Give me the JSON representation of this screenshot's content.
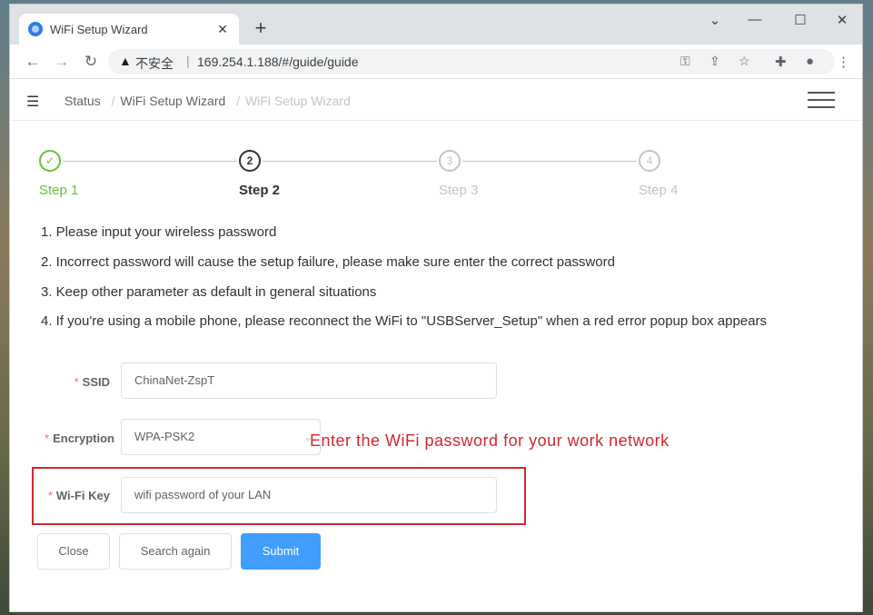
{
  "browser": {
    "tab_title": "WiFi Setup Wizard",
    "tab_close": "✕",
    "new_tab": "+",
    "window_controls": {
      "collapse": "⌄",
      "minimize": "—",
      "maximize": "☐",
      "close": "✕"
    },
    "nav": {
      "back": "←",
      "forward": "→",
      "reload": "↻"
    },
    "security_label": "不安全",
    "separator": "|",
    "url": "169.254.1.188/#/guide/guide",
    "icons": [
      "key-icon",
      "share-icon",
      "star-icon",
      "extensions-icon",
      "profile-icon",
      "more-icon"
    ]
  },
  "breadcrumb": {
    "items": [
      "Status",
      "WiFi Setup Wizard",
      "WiFi Setup Wizard"
    ],
    "separator": "/"
  },
  "steps": [
    {
      "label": "Step 1",
      "marker": "✓",
      "state": "done"
    },
    {
      "label": "Step 2",
      "marker": "2",
      "state": "active"
    },
    {
      "label": "Step 3",
      "marker": "3",
      "state": "pending"
    },
    {
      "label": "Step 4",
      "marker": "4",
      "state": "pending"
    }
  ],
  "instructions": [
    "1. Please input your wireless password",
    "2. Incorrect password will cause the setup failure, please make sure enter the correct password",
    "3. Keep other parameter as default in general situations",
    "4. If you're using a mobile phone, please reconnect the WiFi to \"USBServer_Setup\" when a red error popup box appears"
  ],
  "form": {
    "required_mark": "*",
    "ssid_label": "SSID",
    "ssid_value": "ChinaNet-ZspT",
    "encryption_label": "Encryption",
    "encryption_value": "WPA-PSK2",
    "wifi_key_label": "Wi-Fi Key",
    "wifi_key_value": "wifi password of your LAN"
  },
  "callout_text": "Enter the WiFi password for your work network",
  "buttons": {
    "close": "Close",
    "search_again": "Search again",
    "submit": "Submit"
  },
  "colors": {
    "success": "#67c23a",
    "primary": "#409eff",
    "callout": "#d0282e",
    "required": "#f56c6c"
  }
}
